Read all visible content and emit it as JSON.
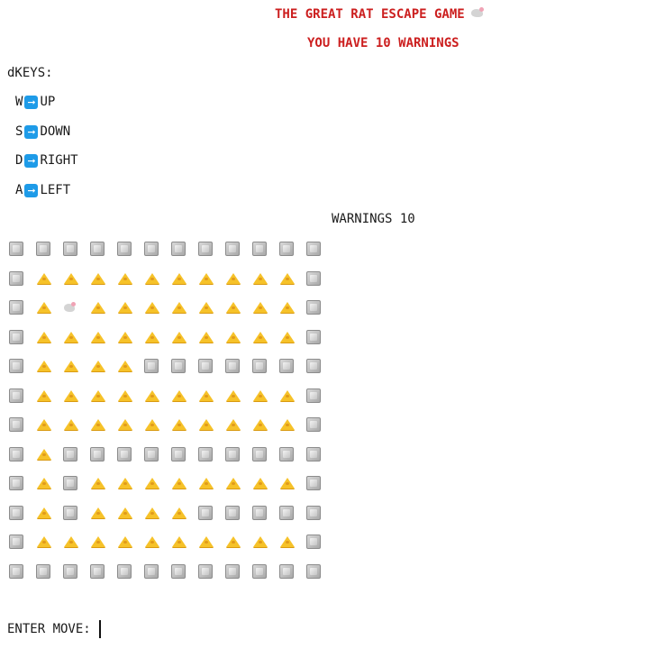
{
  "header": {
    "title": "THE GREAT RAT ESCAPE GAME",
    "title_icon": "rat-icon",
    "warnings_banner": "YOU HAVE 10 WARNINGS"
  },
  "keys": {
    "title": "dKEYS:",
    "arrow_icon": "right-arrow-icon",
    "items": [
      {
        "key": "W",
        "action": "UP"
      },
      {
        "key": "S",
        "action": "DOWN"
      },
      {
        "key": "D",
        "action": "RIGHT"
      },
      {
        "key": "A",
        "action": "LEFT"
      }
    ]
  },
  "status": {
    "warnings_line": "WARNINGS 10"
  },
  "legend": {
    "W": "wall-block-icon",
    "C": "cheese-icon",
    "R": "rat-icon"
  },
  "maze": [
    "WWWWWWWWWWWW",
    "WCCCCCCCCCCW",
    "WCRCCCCCCCCW",
    "WCCCCCCCCCCW",
    "WCCCCWWWWWWW",
    "WCCCCCCCCCCW",
    "WCCCCCCCCCCW",
    "WCWWWWWWWWWW",
    "WCWCCCCCCCCW",
    "WCWCCCCWWWWW",
    "WCCCCCCCCCCW",
    "WWWWWWWWWWWW"
  ],
  "prompt": {
    "label": "ENTER MOVE:",
    "value": ""
  },
  "colors": {
    "title": "#cc1f1f",
    "arrow_box": "#1e9be8",
    "cheese": "#f6c229",
    "wall": "#a8a8a8"
  }
}
